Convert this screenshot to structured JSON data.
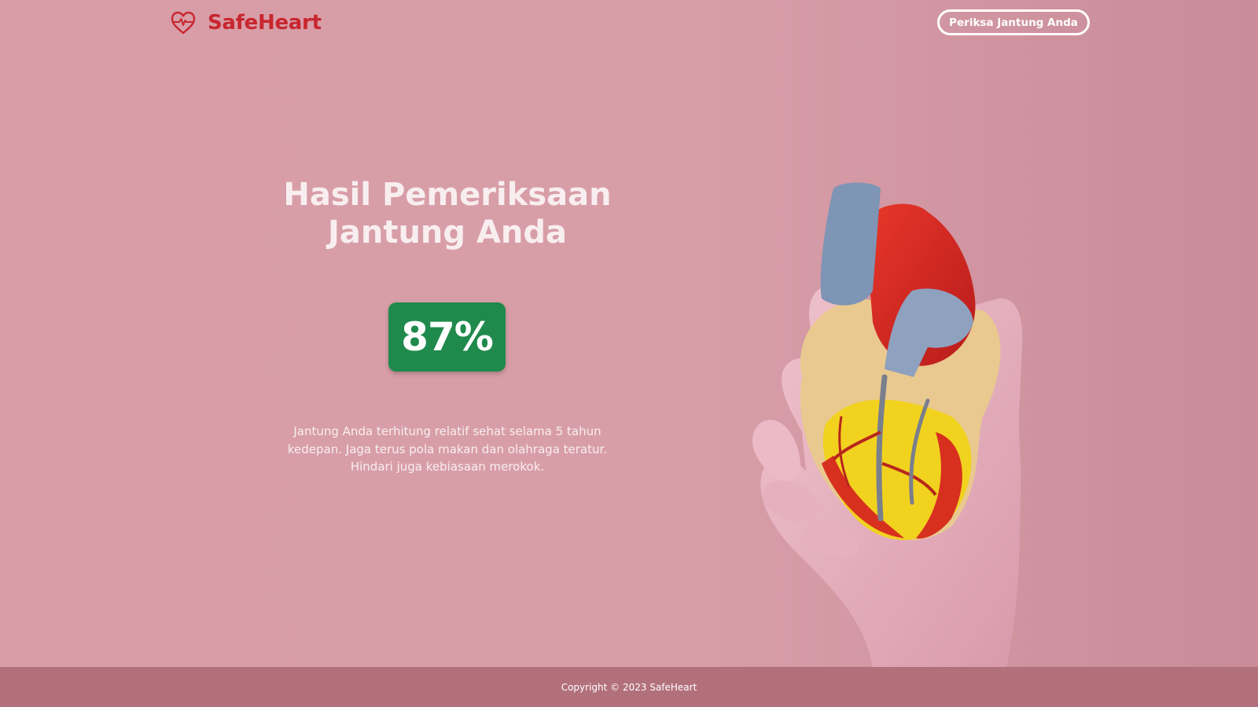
{
  "brand": {
    "name": "SafeHeart",
    "logo_icon": "heart-pulse-icon",
    "color": "#c8262e"
  },
  "header": {
    "cta_label": "Periksa Jantung Anda"
  },
  "result": {
    "title_line1": "Hasil Pemeriksaan",
    "title_line2": "Jantung Anda",
    "score": "87%",
    "score_color": "#1f8a4c",
    "description": "Jantung Anda terhitung relatif sehat selama 5 tahun kedepan. Jaga terus pola makan dan olahraga teratur. Hindari juga kebiasaan merokok."
  },
  "illustration": {
    "icon": "gloved-hand-holding-heart-model"
  },
  "footer": {
    "copyright": "Copyright © 2023 SafeHeart"
  },
  "colors": {
    "background": "#d89ea8",
    "footer": "#b2707b"
  }
}
